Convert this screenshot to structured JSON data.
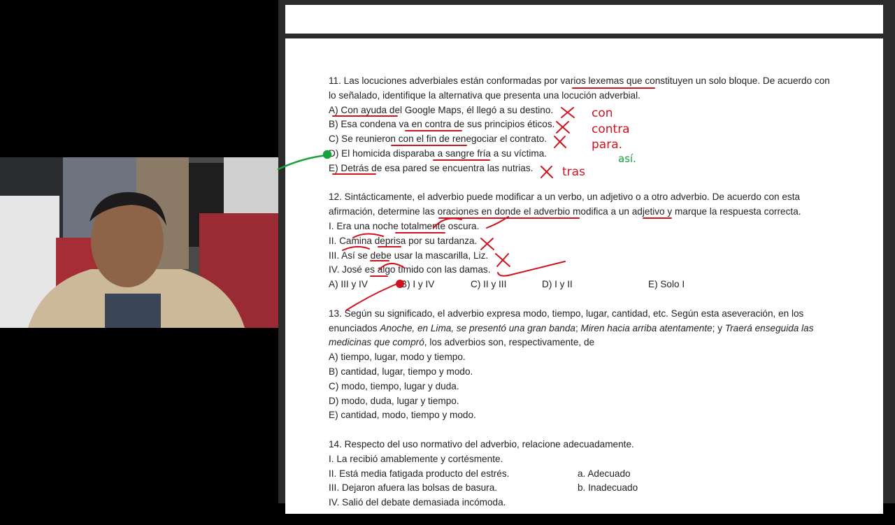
{
  "q11": {
    "lines": [
      "11. Las locuciones adverbiales están conformadas por varios lexemas que constituyen un solo bloque. De acuerdo con",
      "lo señalado, identifique la alternativa que presenta una locución adverbial."
    ],
    "options": [
      "A) Con ayuda del Google Maps, él llegó a su destino.",
      "B) Esa condena va en contra de sus principios éticos.",
      "C) Se reunieron con el fin de renegociar el contrato.",
      "D) El homicida disparaba a sangre fría a su víctima.",
      "E) Detrás de esa pared se encuentra las nutrias."
    ]
  },
  "q12": {
    "lines": [
      "12. Sintácticamente, el adverbio puede modificar a un verbo, un adjetivo o a otro adverbio. De acuerdo con esta",
      "afirmación, determine las oraciones en donde el adverbio modifica a un adjetivo y marque la respuesta correcta."
    ],
    "items": [
      "I. Era una noche totalmente oscura.",
      "II. Camina deprisa por su tardanza.",
      "III. Así se debe usar la mascarilla, Liz.",
      "IV. José es algo tímido con las damas."
    ],
    "answers": [
      "A) III y IV",
      "B) I y IV",
      "C) II y III",
      "D) I y II",
      "E) Solo I"
    ]
  },
  "q13": {
    "line1": "13. Según su significado, el adverbio expresa modo, tiempo, lugar, cantidad, etc. Según esta aseveración, en los",
    "line2_a": "enunciados ",
    "line2_i1": "Anoche, en Lima, se presentó una gran banda",
    "line2_b": "; ",
    "line2_i2": "Miren hacia arriba atentamente",
    "line2_c": "; y ",
    "line2_i3": "Traerá enseguida las",
    "line3_i": "medicinas que compró",
    "line3_b": ", los adverbios son, respectivamente, de",
    "options": [
      "A) tiempo, lugar, modo y tiempo.",
      "B) cantidad, lugar, tiempo y modo.",
      "C) modo, tiempo, lugar y duda.",
      "D) modo, duda, lugar y tiempo.",
      "E) cantidad, modo, tiempo y modo."
    ]
  },
  "q14": {
    "line1": "14. Respecto del uso normativo del adverbio, relacione adecuadamente.",
    "items": [
      "I. La recibió amablemente y cortésmente.",
      "II. Está media fatigada producto del estrés.",
      "III. Dejaron afuera las bolsas de basura.",
      "IV. Salió del debate demasiada incómoda."
    ],
    "labels": [
      "a. Adecuado",
      "b. Inadecuado"
    ]
  },
  "annotations": {
    "con": "con",
    "contra": "contra",
    "para": "para.",
    "asi": "así.",
    "tras": "tras"
  },
  "colors": {
    "ink_red": "#d1121f",
    "ink_green": "#18a33a"
  }
}
